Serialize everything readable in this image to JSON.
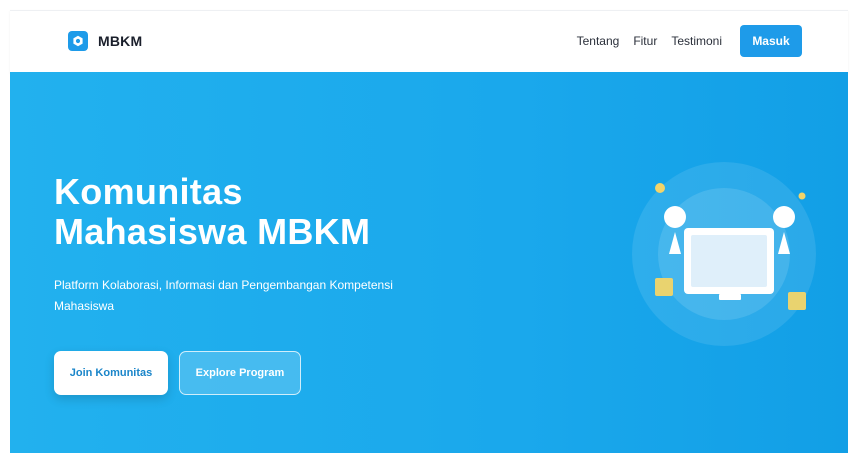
{
  "brand": {
    "name": "MBKM",
    "logo_icon": "hexagon-logo-icon",
    "accent_color": "#1e9be9"
  },
  "nav": {
    "links": [
      {
        "label": "Tentang"
      },
      {
        "label": "Fitur"
      },
      {
        "label": "Testimoni"
      }
    ],
    "login_label": "Masuk"
  },
  "hero": {
    "title_line1": "Komunitas",
    "title_line2": "Mahasiswa MBKM",
    "subtitle": "Platform Kolaborasi, Informasi dan Pengembangan Kompetensi Mahasiswa",
    "primary_button": "Join Komunitas",
    "secondary_button": "Explore Program",
    "background_color": "#1aa8ec",
    "illustration_icon": "computer-collaboration-illustration"
  }
}
